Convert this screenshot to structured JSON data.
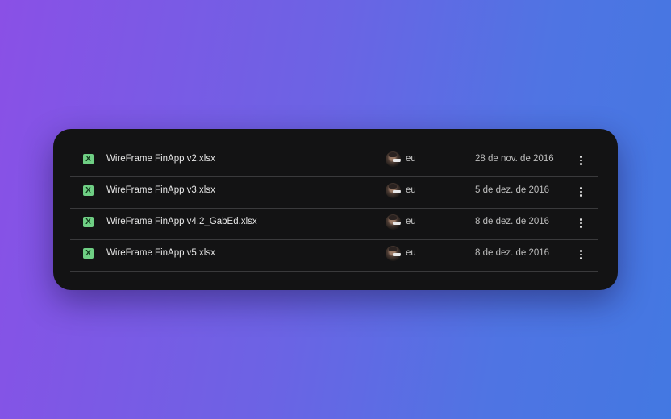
{
  "files": [
    {
      "icon": "excel-icon",
      "icon_letter": "X",
      "name": "WireFrame FinApp v2.xlsx",
      "owner": "eu",
      "modified": "28 de nov. de 2016"
    },
    {
      "icon": "excel-icon",
      "icon_letter": "X",
      "name": "WireFrame FinApp v3.xlsx",
      "owner": "eu",
      "modified": "5 de dez. de 2016"
    },
    {
      "icon": "excel-icon",
      "icon_letter": "X",
      "name": "WireFrame FinApp v4.2_GabEd.xlsx",
      "owner": "eu",
      "modified": "8 de dez. de 2016"
    },
    {
      "icon": "excel-icon",
      "icon_letter": "X",
      "name": "WireFrame FinApp v5.xlsx",
      "owner": "eu",
      "modified": "8 de dez. de 2016"
    }
  ],
  "colors": {
    "panel_background": "#131314",
    "excel_icon": "#6fcf84",
    "divider": "#3a3a3c"
  }
}
